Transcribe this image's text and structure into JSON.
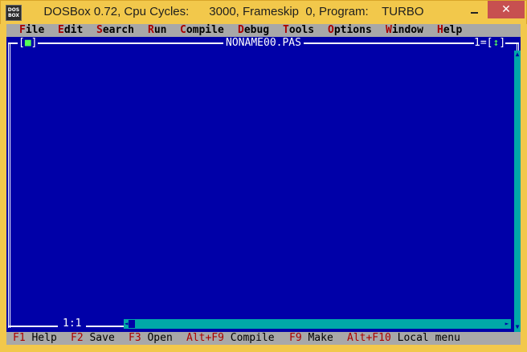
{
  "window": {
    "icon_line1": "DOS",
    "icon_line2": "BOX",
    "title": "DOSBox 0.72, Cpu Cycles:      3000, Frameskip  0, Program:    TURBO",
    "minimize_label": "minimize",
    "maximize_label": "maximize",
    "close_glyph": "✕"
  },
  "menu": {
    "items": [
      {
        "hot": "F",
        "rest": "ile"
      },
      {
        "hot": "E",
        "rest": "dit"
      },
      {
        "hot": "S",
        "rest": "earch"
      },
      {
        "hot": "R",
        "rest": "un"
      },
      {
        "hot": "C",
        "rest": "ompile"
      },
      {
        "hot": "D",
        "rest": "ebug"
      },
      {
        "hot": "T",
        "rest": "ools"
      },
      {
        "hot": "O",
        "rest": "ptions"
      },
      {
        "hot": "W",
        "rest": "indow"
      },
      {
        "hot": "H",
        "rest": "elp"
      }
    ]
  },
  "editor": {
    "close_left": "[",
    "close_glyph": "■",
    "close_right": "]",
    "title": "NONAME00.PAS",
    "window_number": "1",
    "zoom_left": "[",
    "zoom_glyph": "↕",
    "zoom_right": "]",
    "cursor_position": "1:1",
    "scroll_up_glyph": "▲",
    "scroll_down_glyph": "▼",
    "scroll_left_glyph": "◄",
    "scroll_right_glyph": "►"
  },
  "status": {
    "items": [
      {
        "key": "F1",
        "label": " Help"
      },
      {
        "key": "F2",
        "label": " Save"
      },
      {
        "key": "F3",
        "label": " Open"
      },
      {
        "key": "Alt+F9",
        "label": " Compile"
      },
      {
        "key": "F9",
        "label": " Make"
      },
      {
        "key": "Alt+F10",
        "label": " Local menu"
      }
    ]
  },
  "colors": {
    "dos_blue": "#0000A8",
    "dos_gray": "#A8A8A8",
    "dos_red": "#A80000",
    "dos_cyan": "#00A8A8",
    "dos_green": "#55FF55",
    "titlebar_gold": "#F2C84B",
    "close_red": "#C75050"
  }
}
